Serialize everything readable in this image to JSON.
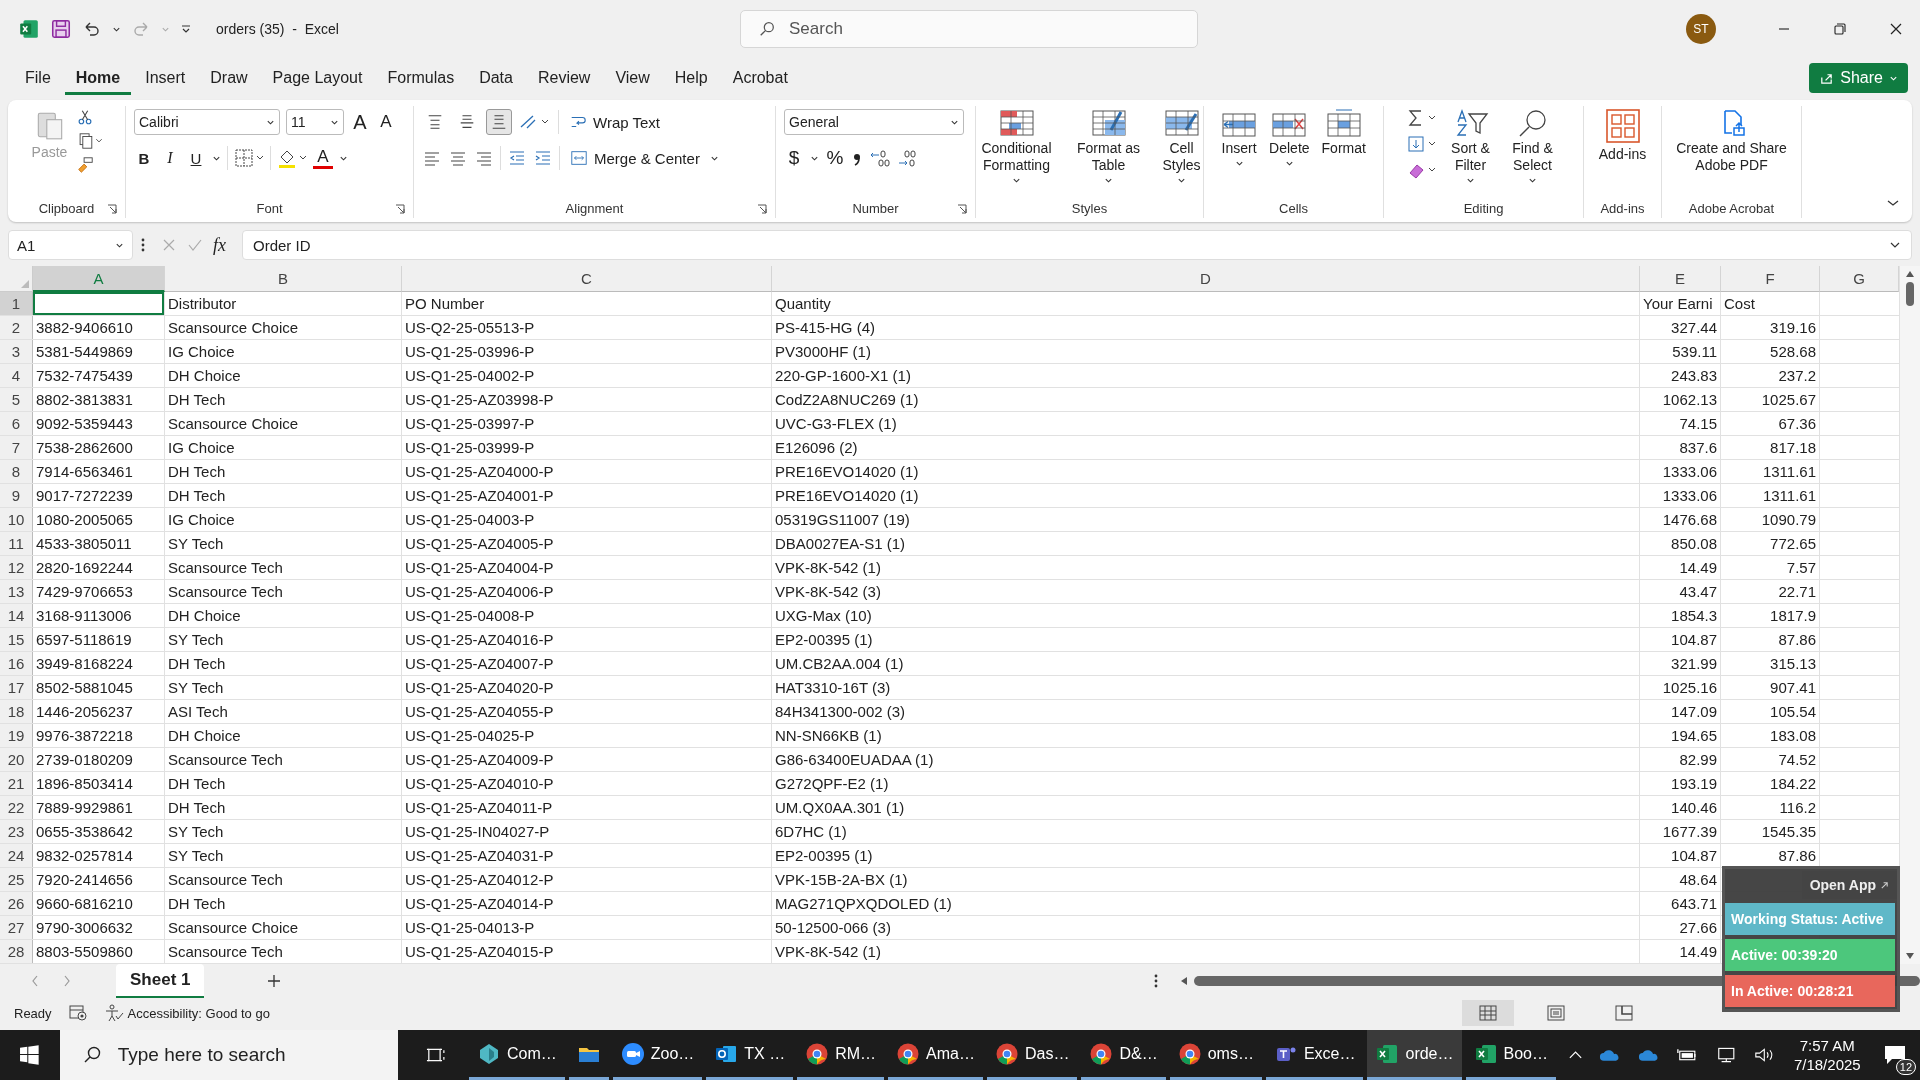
{
  "window": {
    "title": "orders (35)  -  Excel",
    "user_initials": "ST"
  },
  "search": {
    "placeholder": "Search"
  },
  "menu_tabs": [
    {
      "label": "File",
      "selected": false
    },
    {
      "label": "Home",
      "selected": true
    },
    {
      "label": "Insert",
      "selected": false
    },
    {
      "label": "Draw",
      "selected": false
    },
    {
      "label": "Page Layout",
      "selected": false
    },
    {
      "label": "Formulas",
      "selected": false
    },
    {
      "label": "Data",
      "selected": false
    },
    {
      "label": "Review",
      "selected": false
    },
    {
      "label": "View",
      "selected": false
    },
    {
      "label": "Help",
      "selected": false
    },
    {
      "label": "Acrobat",
      "selected": false
    }
  ],
  "share_button": "Share",
  "ribbon": {
    "clipboard": {
      "label": "Clipboard",
      "paste": {
        "label": "Paste",
        "disabled": true
      }
    },
    "font": {
      "label": "Font",
      "name": "Calibri",
      "size": "11",
      "grow": "A",
      "shrink": "A",
      "bold": "B",
      "italic": "I",
      "underline": "U",
      "font_color": "A"
    },
    "alignment": {
      "label": "Alignment",
      "wrap": "Wrap Text",
      "merge": "Merge & Center",
      "vertical": [
        {
          "kind": "top",
          "selected": false
        },
        {
          "kind": "middle",
          "selected": false
        },
        {
          "kind": "bottom",
          "selected": true
        }
      ]
    },
    "number": {
      "label": "Number",
      "format": "General",
      "currency": "$",
      "percent": "%"
    },
    "styles": {
      "label": "Styles",
      "buttons": [
        "Conditional Formatting",
        "Format as Table",
        "Cell Styles"
      ]
    },
    "cells": {
      "label": "Cells",
      "buttons": [
        "Insert",
        "Delete",
        "Format"
      ]
    },
    "editing": {
      "label": "Editing",
      "buttons": [
        "Sort & Filter",
        "Find & Select"
      ]
    },
    "addins": {
      "label": "Add-ins",
      "buttons": [
        "Add-ins"
      ]
    },
    "acrobat": {
      "label": "Adobe Acrobat",
      "buttons": [
        "Create and Share Adobe PDF"
      ]
    }
  },
  "formula_bar": {
    "name_box": "A1",
    "fx": "fx",
    "value": "Order ID"
  },
  "columns": [
    {
      "letter": "A",
      "selected": true
    },
    {
      "letter": "B",
      "selected": false
    },
    {
      "letter": "C",
      "selected": false
    },
    {
      "letter": "D",
      "selected": false
    },
    {
      "letter": "E",
      "selected": false
    },
    {
      "letter": "F",
      "selected": false
    },
    {
      "letter": "G",
      "selected": false
    }
  ],
  "rows": [
    {
      "n": "1",
      "b": "Distributor",
      "c": "PO Number",
      "d": "Quantity",
      "e": "Your Earni",
      "f": "Cost"
    },
    {
      "n": "2",
      "a": "3882-9406610",
      "b": "Scansource Choice",
      "c": "US-Q2-25-05513-P",
      "d": "PS-415-HG (4)",
      "e": "327.44",
      "f": "319.16"
    },
    {
      "n": "3",
      "a": "5381-5449869",
      "b": "IG Choice",
      "c": "US-Q1-25-03996-P",
      "d": "PV3000HF (1)",
      "e": "539.11",
      "f": "528.68"
    },
    {
      "n": "4",
      "a": "7532-7475439",
      "b": "DH Choice",
      "c": "US-Q1-25-04002-P",
      "d": "220-GP-1600-X1 (1)",
      "e": "243.83",
      "f": "237.2"
    },
    {
      "n": "5",
      "a": "8802-3813831",
      "b": "DH Tech",
      "c": "US-Q1-25-AZ03998-P",
      "d": "CodZ2A8NUC269 (1)",
      "e": "1062.13",
      "f": "1025.67"
    },
    {
      "n": "6",
      "a": "9092-5359443",
      "b": "Scansource Choice",
      "c": "US-Q1-25-03997-P",
      "d": "UVC-G3-FLEX (1)",
      "e": "74.15",
      "f": "67.36"
    },
    {
      "n": "7",
      "a": "7538-2862600",
      "b": "IG Choice",
      "c": "US-Q1-25-03999-P",
      "d": "E126096 (2)",
      "e": "837.6",
      "f": "817.18"
    },
    {
      "n": "8",
      "a": "7914-6563461",
      "b": "DH Tech",
      "c": "US-Q1-25-AZ04000-P",
      "d": "PRE16EVO14020 (1)",
      "e": "1333.06",
      "f": "1311.61"
    },
    {
      "n": "9",
      "a": "9017-7272239",
      "b": "DH Tech",
      "c": "US-Q1-25-AZ04001-P",
      "d": "PRE16EVO14020 (1)",
      "e": "1333.06",
      "f": "1311.61"
    },
    {
      "n": "10",
      "a": "1080-2005065",
      "b": "IG Choice",
      "c": "US-Q1-25-04003-P",
      "d": "05319GS11007 (19)",
      "e": "1476.68",
      "f": "1090.79"
    },
    {
      "n": "11",
      "a": "4533-3805011",
      "b": "SY Tech",
      "c": "US-Q1-25-AZ04005-P",
      "d": "DBA0027EA-S1 (1)",
      "e": "850.08",
      "f": "772.65"
    },
    {
      "n": "12",
      "a": "2820-1692244",
      "b": "Scansource Tech",
      "c": "US-Q1-25-AZ04004-P",
      "d": "VPK-8K-542 (1)",
      "e": "14.49",
      "f": "7.57"
    },
    {
      "n": "13",
      "a": "7429-9706653",
      "b": "Scansource Tech",
      "c": "US-Q1-25-AZ04006-P",
      "d": "VPK-8K-542 (3)",
      "e": "43.47",
      "f": "22.71"
    },
    {
      "n": "14",
      "a": "3168-9113006",
      "b": "DH Choice",
      "c": "US-Q1-25-04008-P",
      "d": "UXG-Max (10)",
      "e": "1854.3",
      "f": "1817.9"
    },
    {
      "n": "15",
      "a": "6597-5118619",
      "b": "SY Tech",
      "c": "US-Q1-25-AZ04016-P",
      "d": "EP2-00395 (1)",
      "e": "104.87",
      "f": "87.86"
    },
    {
      "n": "16",
      "a": "3949-8168224",
      "b": "DH Tech",
      "c": "US-Q1-25-AZ04007-P",
      "d": "UM.CB2AA.004 (1)",
      "e": "321.99",
      "f": "315.13"
    },
    {
      "n": "17",
      "a": "8502-5881045",
      "b": "SY Tech",
      "c": "US-Q1-25-AZ04020-P",
      "d": "HAT3310-16T (3)",
      "e": "1025.16",
      "f": "907.41"
    },
    {
      "n": "18",
      "a": "1446-2056237",
      "b": "ASI Tech",
      "c": "US-Q1-25-AZ04055-P",
      "d": "84H341300-002 (3)",
      "e": "147.09",
      "f": "105.54"
    },
    {
      "n": "19",
      "a": "9976-3872218",
      "b": "DH Choice",
      "c": "US-Q1-25-04025-P",
      "d": "NN-SN66KB (1)",
      "e": "194.65",
      "f": "183.08"
    },
    {
      "n": "20",
      "a": "2739-0180209",
      "b": "Scansource Tech",
      "c": "US-Q1-25-AZ04009-P",
      "d": "G86-63400EUADAA (1)",
      "e": "82.99",
      "f": "74.52"
    },
    {
      "n": "21",
      "a": "1896-8503414",
      "b": "DH Tech",
      "c": "US-Q1-25-AZ04010-P",
      "d": "G272QPF-E2 (1)",
      "e": "193.19",
      "f": "184.22"
    },
    {
      "n": "22",
      "a": "7889-9929861",
      "b": "DH Tech",
      "c": "US-Q1-25-AZ04011-P",
      "d": "UM.QX0AA.301 (1)",
      "e": "140.46",
      "f": "116.2"
    },
    {
      "n": "23",
      "a": "0655-3538642",
      "b": "SY Tech",
      "c": "US-Q1-25-IN04027-P",
      "d": "6D7HC (1)",
      "e": "1677.39",
      "f": "1545.35"
    },
    {
      "n": "24",
      "a": "9832-0257814",
      "b": "SY Tech",
      "c": "US-Q1-25-AZ04031-P",
      "d": "EP2-00395 (1)",
      "e": "104.87",
      "f": "87.86"
    },
    {
      "n": "25",
      "a": "7920-2414656",
      "b": "Scansource Tech",
      "c": "US-Q1-25-AZ04012-P",
      "d": "VPK-15B-2A-BX (1)",
      "e": "48.64"
    },
    {
      "n": "26",
      "a": "9660-6816210",
      "b": "DH Tech",
      "c": "US-Q1-25-AZ04014-P",
      "d": "MAG271QPXQDOLED (1)",
      "e": "643.71"
    },
    {
      "n": "27",
      "a": "9790-3006632",
      "b": "Scansource Choice",
      "c": "US-Q1-25-04013-P",
      "d": "50-12500-066 (3)",
      "e": "27.66"
    },
    {
      "n": "28",
      "a": "8803-5509860",
      "b": "Scansource Tech",
      "c": "US-Q1-25-AZ04015-P",
      "d": "VPK-8K-542 (1)",
      "e": "14.49"
    }
  ],
  "sheets": [
    {
      "label": "Sheet 1",
      "selected": true
    }
  ],
  "status_bar": {
    "ready": "Ready",
    "accessibility": "Accessibility: Good to go",
    "views": [
      {
        "kind": "normal",
        "selected": true
      },
      {
        "kind": "page_layout",
        "selected": false
      },
      {
        "kind": "page_break",
        "selected": false
      }
    ]
  },
  "tracker": {
    "open_app": "Open App",
    "status": "Working Status: Active",
    "active": "Active: 00:39:20",
    "inactive": "In Active: 00:28:21"
  },
  "taskbar": {
    "search_placeholder": "Type here to search",
    "apps": [
      {
        "kind": "teal",
        "label": "Com…",
        "selected": false
      },
      {
        "kind": "explorer",
        "selected": false
      },
      {
        "kind": "zoom",
        "label": "Zoo…",
        "selected": false
      },
      {
        "kind": "outlook",
        "label": "TX …",
        "selected": false
      },
      {
        "kind": "chrome",
        "label": "RM…",
        "selected": false
      },
      {
        "kind": "chrome",
        "label": "Ama…",
        "selected": false
      },
      {
        "kind": "chrome",
        "label": "Das…",
        "selected": false
      },
      {
        "kind": "chrome",
        "label": "D&…",
        "selected": false
      },
      {
        "kind": "chrome",
        "label": "oms…",
        "selected": false
      },
      {
        "kind": "teams",
        "label": "Exce…",
        "selected": false
      },
      {
        "kind": "excel",
        "label": "orde…",
        "selected": true
      },
      {
        "kind": "excel",
        "label": "Boo…",
        "selected": false
      }
    ],
    "time": "7:57 AM",
    "date": "7/18/2025",
    "notifications": "12"
  }
}
